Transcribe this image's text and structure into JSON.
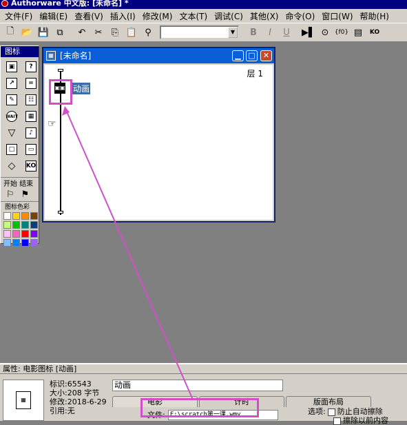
{
  "app": {
    "title": "Authorware 中文版: [未命名] *"
  },
  "menu": [
    "文件(F)",
    "编辑(E)",
    "查看(V)",
    "插入(I)",
    "修改(M)",
    "文本(T)",
    "调试(C)",
    "其他(X)",
    "命令(O)",
    "窗口(W)",
    "帮助(H)"
  ],
  "toolbar": {
    "icons": [
      "new-icon",
      "open-icon",
      "save-all-icon",
      "import-icon",
      "undo-icon",
      "cut-icon",
      "copy-icon",
      "paste-icon",
      "find-icon"
    ],
    "font_value": "",
    "style": [
      "B",
      "I",
      "U"
    ],
    "right_icons": [
      "run-icon",
      "control-panel-icon",
      "functions-icon",
      "variables-icon",
      "knowledge-objects-icon"
    ]
  },
  "palette": {
    "title": "图标",
    "start_label": "开始",
    "end_label": "结束",
    "color_label": "图标色彩",
    "swatches": [
      "#ffffff",
      "#ffd700",
      "#ff8c00",
      "#804000",
      "#c0ff80",
      "#00c000",
      "#008080",
      "#004080",
      "#ffc0ff",
      "#ff60c0",
      "#ff0000",
      "#8000ff",
      "#80c0ff",
      "#0080ff",
      "#0000ff",
      "#a060ff"
    ]
  },
  "design_window": {
    "title": "[未命名]",
    "layer": "层 1",
    "icon_label": "动画"
  },
  "properties": {
    "title": "属性: 电影图标 [动画]",
    "info": {
      "id": "标识:65543",
      "size": "大小:208 字节",
      "modified": "修改:2018-6-29",
      "ref": "引用:无"
    },
    "name_value": "动画",
    "tabs": [
      "电影",
      "计时",
      "版面布局"
    ],
    "file_label": "文件:",
    "file_value": "F:\\scratch第一课.wmv",
    "options_label": "选项:",
    "option1": "防止自动擦除",
    "option2": "擦除以前内容"
  },
  "annotation_color": "#d24fc8"
}
